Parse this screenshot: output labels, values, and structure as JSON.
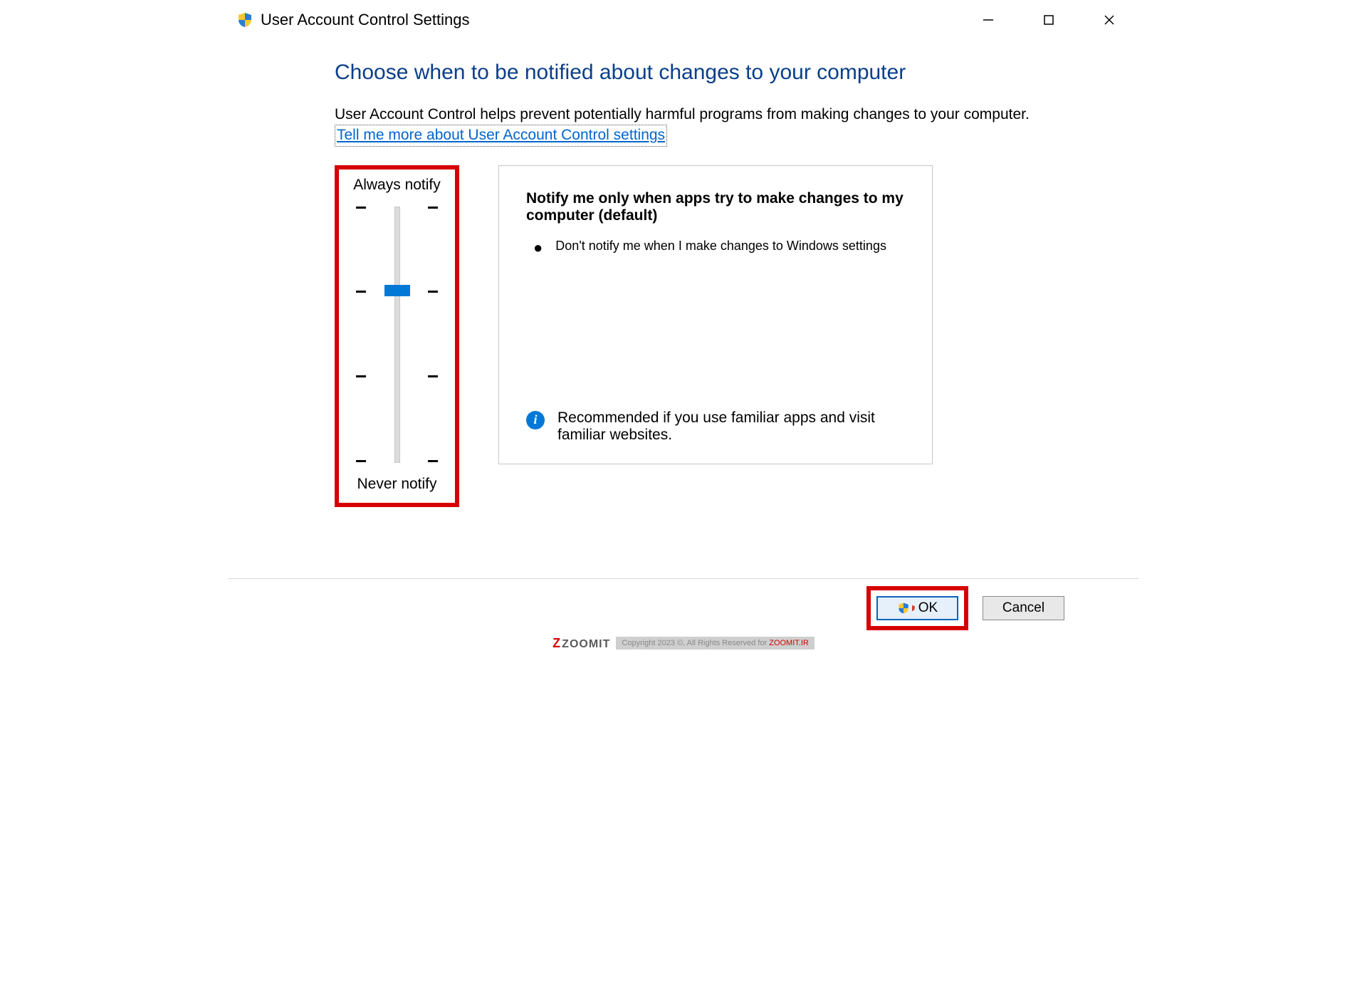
{
  "window": {
    "title": "User Account Control Settings"
  },
  "main": {
    "heading": "Choose when to be notified about changes to your computer",
    "description": "User Account Control helps prevent potentially harmful programs from making changes to your computer.",
    "link_text": "Tell me more about User Account Control settings"
  },
  "slider": {
    "top_label": "Always notify",
    "bottom_label": "Never notify",
    "levels": 4,
    "selected_index": 1
  },
  "detail": {
    "title": "Notify me only when apps try to make changes to my computer (default)",
    "bullet": "Don't notify me when I make changes to Windows settings",
    "recommendation": "Recommended if you use familiar apps and visit familiar websites."
  },
  "footer": {
    "ok_label": "OK",
    "cancel_label": "Cancel"
  },
  "watermark": {
    "brand": "ZOOMIT",
    "copyright": "Copyright 2023 ©, All Rights Reserved for ",
    "site": "ZOOMIT.IR"
  }
}
